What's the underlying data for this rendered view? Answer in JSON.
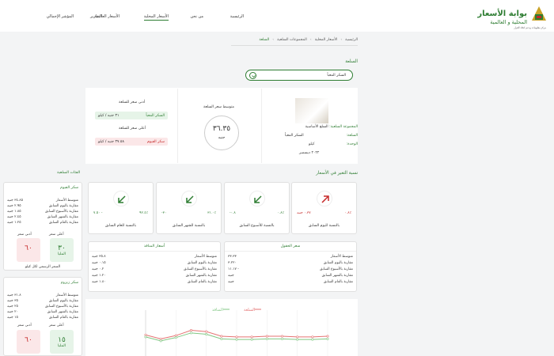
{
  "header": {
    "logo_title": "بوابة الأسعار",
    "logo_subtitle": "المحلية و العالمية",
    "logo_caption": "مركز معلومات ودعم اتخاذ القرار",
    "nav": [
      {
        "label": "الرئيسية"
      },
      {
        "label": "من نحن"
      },
      {
        "label": "الأسعار المحلية"
      },
      {
        "label": "الأسعار العالمية"
      },
      {
        "label": "التقارير"
      },
      {
        "label": "المؤشر الإجمالي"
      }
    ]
  },
  "breadcrumb": [
    {
      "label": "الرئيسية"
    },
    {
      "label": "الأسعار المحلية"
    },
    {
      "label": "المجموعات السلعية"
    },
    {
      "label": "السلعة"
    }
  ],
  "commodity_section": {
    "title": "السلعة",
    "select_value": "السكر المعبأ"
  },
  "commodity_info": {
    "group_label": "المجموعة السلعية:",
    "group_value": "السلع الأساسية",
    "commodity_label": "السلعة:",
    "commodity_value": "السكر المعبأ",
    "unit_label": "الوحدة:",
    "unit_value": "كيلو",
    "date": "٢٠٢٢ ديسمبر"
  },
  "average_price": {
    "label": "متوسط سعر السلعة",
    "value": "٣٦.٣٥",
    "currency": "جنيه"
  },
  "min_price": {
    "label": "أدنى سعر للسلعة",
    "name": "السكر المعبأ",
    "value": "٣١ جنيه / كيلو"
  },
  "max_price": {
    "label": "أعلى سعر للسلعة",
    "name": "سكر الفيوم",
    "value": "٣٧.٥٨ جنيه / كيلو"
  },
  "change_section": {
    "title": "نسبة التغير في الأسعار",
    "cards": [
      {
        "label": "بالنسبة لليوم السابق",
        "pct": "٠.٨٪",
        "delta": "٠.٣٧ جنيه",
        "dir": "up",
        "color": "#c62828"
      },
      {
        "label": "بالنسبة للأسبوع السابق",
        "pct": "٠.٨٪",
        "delta": "-٠.٨",
        "dir": "down",
        "color": "#2e7d32"
      },
      {
        "label": "بالنسبة للشهر السابق",
        "pct": "٣١.٠٪",
        "delta": "-٣٠",
        "dir": "down",
        "color": "#2e7d32"
      },
      {
        "label": "بالنسبة للعام السابق",
        "pct": "٩٢.٤٪",
        "delta": "٧.٥٠ -",
        "dir": "down",
        "color": "#2e7d32"
      }
    ]
  },
  "wholesale": {
    "title": "سعر الحقول",
    "rows": [
      {
        "k": "متوسط الأسعار",
        "v": "٣٣.٣٣"
      },
      {
        "k": "مقارنة باليوم السابق",
        "v": "٣.٢٢٠"
      },
      {
        "k": "مقارنة بالأسبوع السابق",
        "v": "١١.١٧ -"
      },
      {
        "k": "مقارنة بالشهر السابق",
        "v": "جنيه"
      },
      {
        "k": "مقارنة بالعام السابق",
        "v": "جنيه"
      }
    ]
  },
  "markets": {
    "title": "أسعار المنافذ",
    "rows": [
      {
        "k": "متوسط الأسعار",
        "v": "٣٥.٨ جنيه"
      },
      {
        "k": "مقارنة باليوم السابق",
        "v": "٠.١٥ جنيه"
      },
      {
        "k": "مقارنة بالأسبوع السابق",
        "v": "٠.٢ جنيه"
      },
      {
        "k": "مقارنة بالشهر السابق",
        "v": "١.٢٠ جنيه"
      },
      {
        "k": "مقارنة بالعام السابق",
        "v": "١.٨٠ جنيه"
      }
    ]
  },
  "sidebar": {
    "title": "الفئات السلعية",
    "items": [
      {
        "name": "سكر الفيوم",
        "rows": [
          {
            "k": "متوسط الأسعار",
            "v": "٣٤.٨٥ جنيه"
          },
          {
            "k": "مقارنة باليوم السابق",
            "v": "٢.٩٥ جنيه"
          },
          {
            "k": "مقارنة بالأسبوع السابق",
            "v": "١.٨٥ جنيه"
          },
          {
            "k": "مقارنة بالشهر السابق",
            "v": "٢.٤٥ جنيه"
          },
          {
            "k": "مقارنة بالعام السابق",
            "v": "١.٢٥ جنيه"
          }
        ],
        "max_label": "أعلى سعر",
        "max_value": "٣٠",
        "max_unit": "المليا",
        "min_label": "أدنى سعر",
        "min_value": "٦٠",
        "footer": "السعر الرسمي لكل كيلو"
      },
      {
        "name": "سكر زيزوم",
        "rows": [
          {
            "k": "متوسط الأسعار",
            "v": "٣١.٨ جنيه"
          },
          {
            "k": "مقارنة باليوم السابق",
            "v": "٣٥ جنيه"
          },
          {
            "k": "مقارنة بالأسبوع السابق",
            "v": "٢٥ جنيه"
          },
          {
            "k": "مقارنة بالشهر السابق",
            "v": "٢٠ جنيه"
          },
          {
            "k": "مقارنة بالعام السابق",
            "v": "١٥ جنيه"
          }
        ],
        "max_label": "أعلى سعر",
        "max_value": "١٥",
        "max_unit": "المليا",
        "min_label": "أدنى سعر",
        "min_value": "٦٠"
      }
    ]
  },
  "chart_data": {
    "type": "line",
    "series": [
      {
        "name": "السلعة",
        "color": "#e57373",
        "values": [
          33.2,
          32.6,
          33.1,
          33.9,
          33.7,
          33.0,
          32.9,
          32.9,
          33.0,
          33.0,
          32.9,
          32.9,
          33.0
        ]
      },
      {
        "name": "المنافذ",
        "color": "#81c784",
        "values": [
          32.9,
          32.3,
          32.8,
          33.5,
          33.3,
          32.6,
          32.5,
          32.5,
          32.6,
          32.6,
          32.5,
          32.5,
          32.6
        ]
      }
    ],
    "ylim": [
      30,
      36
    ],
    "grid": true,
    "legend": "top"
  }
}
